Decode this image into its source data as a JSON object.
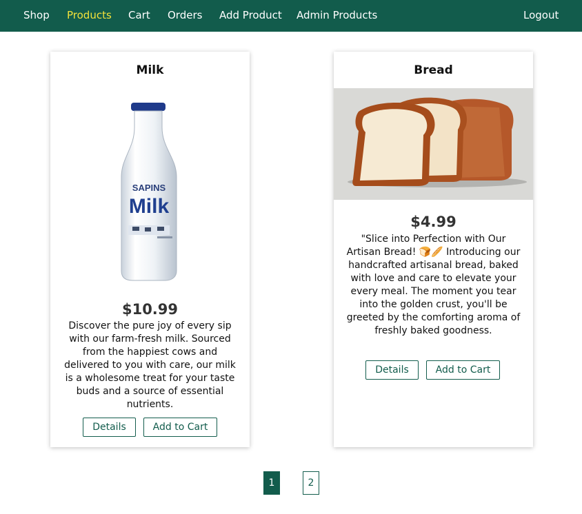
{
  "nav": {
    "items": [
      {
        "label": "Shop"
      },
      {
        "label": "Products"
      },
      {
        "label": "Cart"
      },
      {
        "label": "Orders"
      },
      {
        "label": "Add Product"
      },
      {
        "label": "Admin Products"
      }
    ],
    "logout_label": "Logout",
    "active_item": "Products"
  },
  "products": [
    {
      "title": "Milk",
      "price": "$10.99",
      "description": "Discover the pure joy of every sip with our farm-fresh milk. Sourced from the happiest cows and delivered to you with care, our milk is a wholesome treat for your taste buds and a source of essential nutrients.",
      "bottle_brand": "SAPINS",
      "bottle_label": "Milk",
      "details_label": "Details",
      "add_to_cart_label": "Add to Cart"
    },
    {
      "title": "Bread",
      "price": "$4.99",
      "description": "\"Slice into Perfection with Our Artisan Bread! 🍞🥖 Introducing our handcrafted artisanal bread, baked with love and care to elevate your every meal. The moment you tear into the golden crust, you'll be greeted by the comforting aroma of freshly baked goodness.",
      "details_label": "Details",
      "add_to_cart_label": "Add to Cart"
    }
  ],
  "pagination": {
    "pages": [
      "1",
      "2"
    ],
    "current": "1"
  },
  "colors": {
    "primary": "#125c4c",
    "active_nav": "#f3e23a"
  }
}
